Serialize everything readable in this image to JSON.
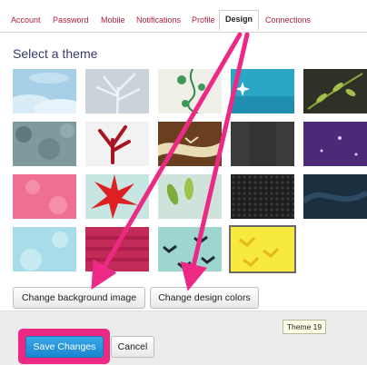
{
  "tabs": [
    {
      "label": "Account"
    },
    {
      "label": "Password"
    },
    {
      "label": "Mobile"
    },
    {
      "label": "Notifications"
    },
    {
      "label": "Profile"
    },
    {
      "label": "Design",
      "active": true
    },
    {
      "label": "Connections"
    }
  ],
  "section_title": "Select a theme",
  "themes": {
    "selected": "Theme 19",
    "items": [
      {
        "name": "sky-clouds",
        "color": "#a8cfe8"
      },
      {
        "name": "gray-tree",
        "color": "#c9d3d9"
      },
      {
        "name": "green-vines",
        "color": "#efefe8"
      },
      {
        "name": "blue-sparkle",
        "color": "#2aa7c7"
      },
      {
        "name": "dark-leaves",
        "color": "#2f3126"
      },
      {
        "name": "gray-foliage",
        "color": "#7f9a9c"
      },
      {
        "name": "red-leaf",
        "color": "#f2f2f2"
      },
      {
        "name": "brown-birds",
        "color": "#6a3f1f"
      },
      {
        "name": "dark-gray",
        "color": "#3b3b3b"
      },
      {
        "name": "purple-stars",
        "color": "#4c2a78"
      },
      {
        "name": "pink-flowers",
        "color": "#ef6f93"
      },
      {
        "name": "red-flowers",
        "color": "#c7e6e2"
      },
      {
        "name": "green-leaves",
        "color": "#cfe3db"
      },
      {
        "name": "black-honeycomb",
        "color": "#1e1e1e"
      },
      {
        "name": "navy-waves",
        "color": "#1a2f40"
      },
      {
        "name": "light-blue-bubbles",
        "color": "#a7dde8"
      },
      {
        "name": "magenta-pattern",
        "color": "#c22a58"
      },
      {
        "name": "teal-birds",
        "color": "#9ed5cf"
      },
      {
        "name": "yellow-birds",
        "color": "#f7e93d"
      }
    ]
  },
  "buttons": {
    "change_background": "Change background image",
    "change_colors": "Change design colors",
    "save": "Save Changes",
    "cancel": "Cancel"
  },
  "tooltip": "Theme 19",
  "colors": {
    "tab_link": "#b0213f",
    "title": "#3b3b6b",
    "annotation": "#ec2a86",
    "save_button": "#2596dd"
  }
}
